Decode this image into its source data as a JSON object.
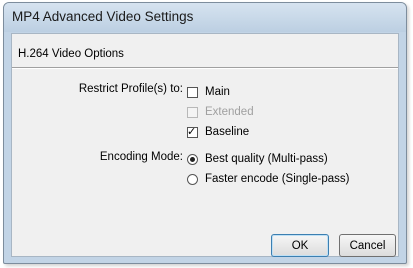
{
  "window": {
    "title": "MP4 Advanced Video Settings"
  },
  "section": {
    "title": "H.264 Video Options"
  },
  "profiles": {
    "label": "Restrict Profile(s) to:",
    "options": [
      {
        "label": "Main",
        "checked": false,
        "disabled": false
      },
      {
        "label": "Extended",
        "checked": false,
        "disabled": true
      },
      {
        "label": "Baseline",
        "checked": true,
        "disabled": false
      }
    ]
  },
  "encoding": {
    "label": "Encoding Mode:",
    "options": [
      {
        "label": "Best quality (Multi-pass)",
        "selected": true
      },
      {
        "label": "Faster encode (Single-pass)",
        "selected": false
      }
    ]
  },
  "buttons": {
    "ok": "OK",
    "cancel": "Cancel"
  }
}
